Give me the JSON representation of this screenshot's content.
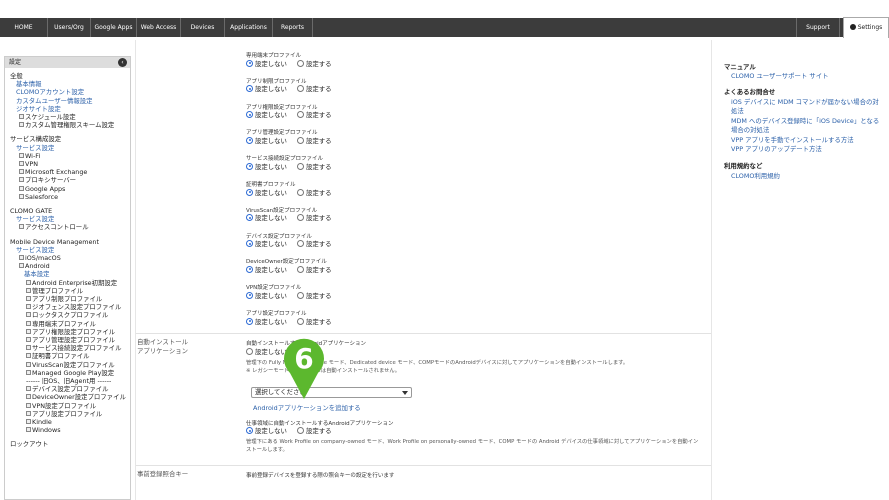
{
  "nav": {
    "items": [
      "HOME",
      "Users/Org",
      "Google Apps",
      "Web Access",
      "Devices",
      "Applications",
      "Reports"
    ],
    "support": "Support",
    "settings": "Settings"
  },
  "left": {
    "header": "設定",
    "lines": [
      {
        "t": "全般",
        "k": "head"
      },
      {
        "t": "基本情報",
        "k": "link"
      },
      {
        "t": "CLOMOアカウント設定",
        "k": "link"
      },
      {
        "t": "カスタムユーザー情報設定",
        "k": "link"
      },
      {
        "t": "ジオサイト設定",
        "k": "link"
      },
      {
        "t": "スケジュール設定",
        "k": "plain",
        "exp": true
      },
      {
        "t": "カスタム管理権限スキーム設定",
        "k": "plain",
        "exp": true
      },
      {
        "t": "サービス構成設定",
        "k": "head"
      },
      {
        "t": "サービス設定",
        "k": "link"
      },
      {
        "t": "Wi-Fi",
        "k": "plain",
        "exp": true
      },
      {
        "t": "VPN",
        "k": "plain",
        "exp": true
      },
      {
        "t": "Microsoft Exchange",
        "k": "plain",
        "exp": true
      },
      {
        "t": "プロキシサーバー",
        "k": "plain",
        "exp": true
      },
      {
        "t": "Google Apps",
        "k": "plain",
        "exp": true
      },
      {
        "t": "Salesforce",
        "k": "plain",
        "exp": true
      },
      {
        "t": "CLOMO GATE",
        "k": "head"
      },
      {
        "t": "サービス設定",
        "k": "link"
      },
      {
        "t": "アクセスコントロール",
        "k": "plain",
        "exp": true
      },
      {
        "t": "Mobile Device Management",
        "k": "head"
      },
      {
        "t": "サービス設定",
        "k": "link"
      },
      {
        "t": "iOS/macOS",
        "k": "plain",
        "exp": true
      },
      {
        "t": "Android",
        "k": "plain",
        "exp": true
      },
      {
        "t": "基本設定",
        "k": "link"
      },
      {
        "t": "Android Enterprise初期設定",
        "k": "plain",
        "exp": true
      },
      {
        "t": "管理プロファイル",
        "k": "plain",
        "exp": true
      },
      {
        "t": "アプリ制限プロファイル",
        "k": "plain",
        "exp": true
      },
      {
        "t": "ジオフェンス設定プロファイル",
        "k": "plain",
        "exp": true
      },
      {
        "t": "ロックタスクプロファイル",
        "k": "plain",
        "exp": true
      },
      {
        "t": "専用端末プロファイル",
        "k": "plain",
        "exp": true
      },
      {
        "t": "アプリ権限設定プロファイル",
        "k": "plain",
        "exp": true
      },
      {
        "t": "アプリ管理設定プロファイル",
        "k": "plain",
        "exp": true
      },
      {
        "t": "サービス接続設定プロファイル",
        "k": "plain",
        "exp": true
      },
      {
        "t": "証明書プロファイル",
        "k": "plain",
        "exp": true
      },
      {
        "t": "VirusScan設定プロファイル",
        "k": "plain",
        "exp": true
      },
      {
        "t": "Managed Google Play設定",
        "k": "plain",
        "exp": true
      },
      {
        "t": "------ 旧OS、旧Agent用 ------",
        "k": "plain"
      },
      {
        "t": "デバイス設定プロファイル",
        "k": "plain",
        "exp": true
      },
      {
        "t": "DeviceOwner設定プロファイル",
        "k": "plain",
        "exp": true
      },
      {
        "t": "VPN設定プロファイル",
        "k": "plain",
        "exp": true
      },
      {
        "t": "アプリ設定プロファイル",
        "k": "plain",
        "exp": true
      },
      {
        "t": "Kindle",
        "k": "plain",
        "exp": true
      },
      {
        "t": "Windows",
        "k": "plain",
        "exp": true
      },
      {
        "t": "ロックアウト",
        "k": "head"
      }
    ]
  },
  "main": {
    "radio_on": "設定しない",
    "radio_off": "設定する",
    "profiles": [
      "専用端末プロファイル",
      "アプリ制限プロファイル",
      "アプリ権限設定プロファイル",
      "アプリ管理設定プロファイル",
      "サービス接続設定プロファイル",
      "証明書プロファイル",
      "VirusScan設定プロファイル",
      "デバイス設定プロファイル",
      "DeviceOwner設定プロファイル",
      "VPN設定プロファイル",
      "アプリ設定プロファイル"
    ],
    "auto_install": {
      "label_line1": "自動インストール",
      "label_line2": "アプリケーション",
      "title": "自動インストールするAndroidアプリケーション",
      "note1": "管理下の Fully Managed Device モード、Dedicated device モード、COMPモードのAndroidデバイスに対してアプリケーションを自動インストールします。",
      "note2": "※ レガシーモードのデバイスには自動インストールされません。",
      "select_value": "選択してください",
      "add_link": "Androidアプリケーションを追加する"
    },
    "work_profile": {
      "title": "仕事領域に自動インストールするAndroidアプリケーション",
      "note_line1": "管理下にある Work Profile on company-owned モード、Work Profile on personally-owned モード、COMP モードの Android デバイスの仕事領域に対してアプリケーションを自動イン",
      "note_line2": "ストールします。"
    },
    "bottom": {
      "label": "事前登録照合キー",
      "text": "事前登録デバイスを登録する際の照合キーの設定を行います"
    },
    "marker_number": "6"
  },
  "right": {
    "manual_head": "マニュアル",
    "manual_link": "CLOMO ユーザーサポート サイト",
    "faq_head": "よくあるお問合せ",
    "faq_lines": [
      "iOS デバイスに MDM コマンドが届かない場合の対",
      "処法",
      "MDM へのデバイス登録時に「iOS Device」となる",
      "場合の対処法",
      "VPP アプリを手動でインストールする方法",
      "VPP アプリのアップデート方法"
    ],
    "terms_head": "利用規約など",
    "terms_link": "CLOMO利用規約"
  },
  "colors": {
    "navbar": "#3c3c3c",
    "link": "#2a5fa8",
    "marker": "#5cb82e",
    "radio": "#2f6cd4"
  }
}
